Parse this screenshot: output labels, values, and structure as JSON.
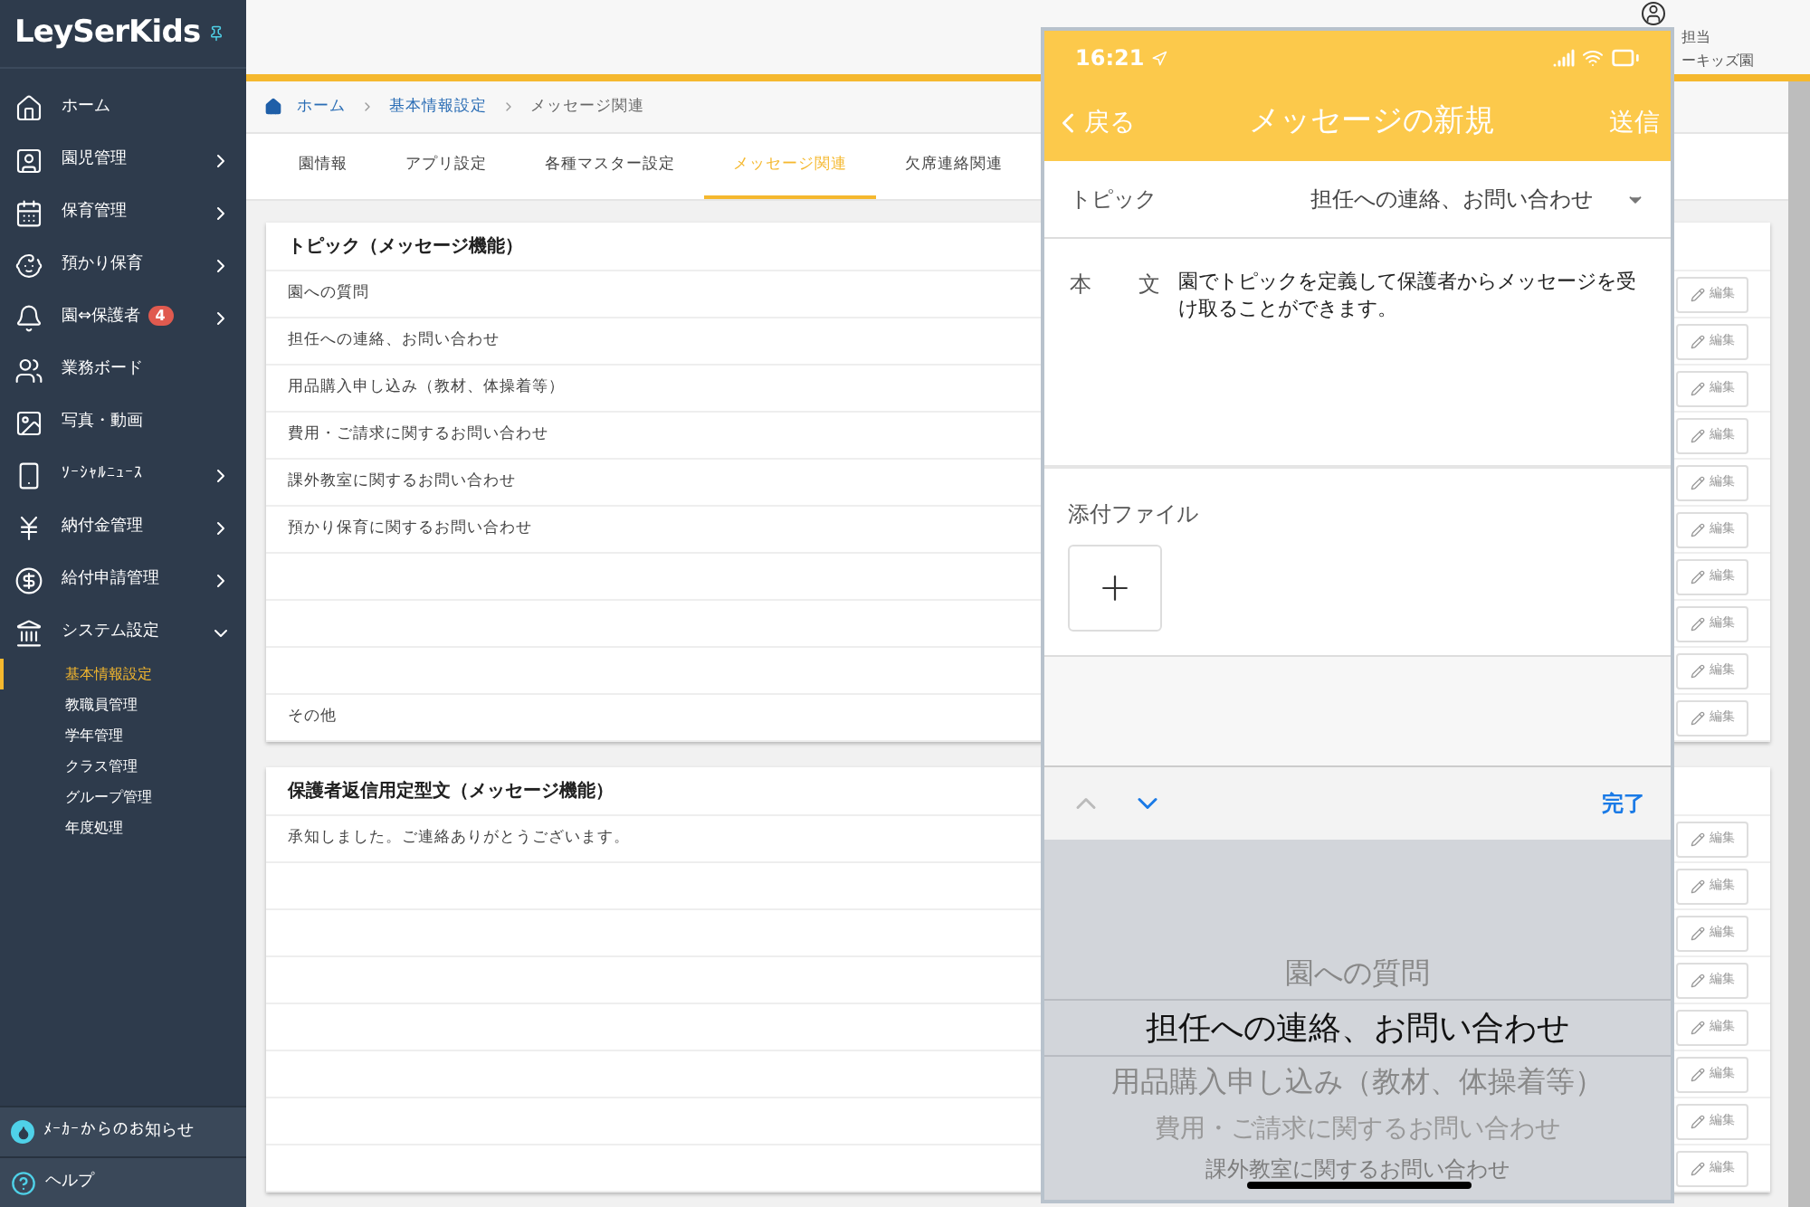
{
  "sidebar": {
    "logo": "LeySerKids",
    "items": [
      {
        "label": "ホーム",
        "kind": "home",
        "arrow": false
      },
      {
        "label": "園児管理",
        "kind": "children",
        "arrow": true
      },
      {
        "label": "保育管理",
        "kind": "calendar",
        "arrow": true
      },
      {
        "label": "預かり保育",
        "kind": "care",
        "arrow": true
      },
      {
        "label": "園⇔保護者",
        "kind": "bell",
        "arrow": true,
        "badge": "4"
      },
      {
        "label": "業務ボード",
        "kind": "board",
        "arrow": false
      },
      {
        "label": "写真・動画",
        "kind": "photo",
        "arrow": false
      },
      {
        "label": "ｿｰｼｬﾙﾆｭｰｽ",
        "kind": "phone",
        "arrow": true
      },
      {
        "label": "納付金管理",
        "kind": "yen",
        "arrow": true
      },
      {
        "label": "給付申請管理",
        "kind": "yendoc",
        "arrow": true
      },
      {
        "label": "システム設定",
        "kind": "building",
        "arrow": true,
        "expanded": true,
        "children": [
          {
            "label": "基本情報設定",
            "selected": true
          },
          {
            "label": "教職員管理",
            "selected": false
          },
          {
            "label": "学年管理",
            "selected": false
          },
          {
            "label": "クラス管理",
            "selected": false
          },
          {
            "label": "グループ管理",
            "selected": false
          },
          {
            "label": "年度処理",
            "selected": false
          }
        ]
      }
    ],
    "footer": [
      {
        "label": "ﾒｰｶｰからのお知らせ",
        "kind": "notice"
      },
      {
        "label": "ヘルプ",
        "kind": "help"
      }
    ]
  },
  "header": {
    "user_line_1": "担当",
    "user_line_2": "ーキッズ園"
  },
  "breadcrumb": [
    "ホーム",
    "基本情報設定",
    "メッセージ関連"
  ],
  "tabs": [
    {
      "label": "園情報",
      "selected": false
    },
    {
      "label": "アプリ設定",
      "selected": false
    },
    {
      "label": "各種マスター設定",
      "selected": false
    },
    {
      "label": "メッセージ関連",
      "selected": true
    },
    {
      "label": "欠席連絡関連",
      "selected": false
    }
  ],
  "cards": [
    {
      "title": "トピック（メッセージ機能）",
      "rows": [
        {
          "text": "園への質問",
          "edit": "編集"
        },
        {
          "text": "担任への連絡、お問い合わせ",
          "edit": "編集"
        },
        {
          "text": "用品購入申し込み（教材、体操着等）",
          "edit": "編集"
        },
        {
          "text": "費用・ご請求に関するお問い合わせ",
          "edit": "編集"
        },
        {
          "text": "課外教室に関するお問い合わせ",
          "edit": "編集"
        },
        {
          "text": "預かり保育に関するお問い合わせ",
          "edit": "編集"
        },
        {
          "edit": "編集"
        },
        {
          "edit": "編集"
        },
        {
          "edit": "編集"
        },
        {
          "text": "その他",
          "edit": "編集"
        }
      ]
    },
    {
      "title": "保護者返信用定型文（メッセージ機能）",
      "rows": [
        {
          "text": "承知しました。ご連絡ありがとうございます。",
          "edit": "編集"
        },
        {
          "edit": "編集"
        },
        {
          "edit": "編集"
        },
        {
          "edit": "編集"
        },
        {
          "edit": "編集"
        },
        {
          "edit": "編集"
        },
        {
          "edit": "編集"
        },
        {
          "edit": "編集"
        }
      ]
    }
  ],
  "phone": {
    "time": "16:21",
    "back": "戻る",
    "title": "メッセージの新規",
    "send": "送信",
    "topic_label": "トピック",
    "topic_value": "担任への連絡、お問い合わせ",
    "body_label": [
      "本",
      "文"
    ],
    "body_text": "園でトピックを定義して保護者からメッセージを受け取ることができます。",
    "attach_label": "添付ファイル",
    "done": "完了",
    "picker": [
      {
        "label": "園への質問",
        "selected": false
      },
      {
        "label": "担任への連絡、お問い合わせ",
        "selected": true
      },
      {
        "label": "用品購入申し込み（教材、体操着等）",
        "selected": false
      },
      {
        "label": "費用・ご請求に関するお問い合わせ",
        "selected": false
      },
      {
        "label": "課外教室に関するお問い合わせ",
        "selected": false
      }
    ]
  }
}
